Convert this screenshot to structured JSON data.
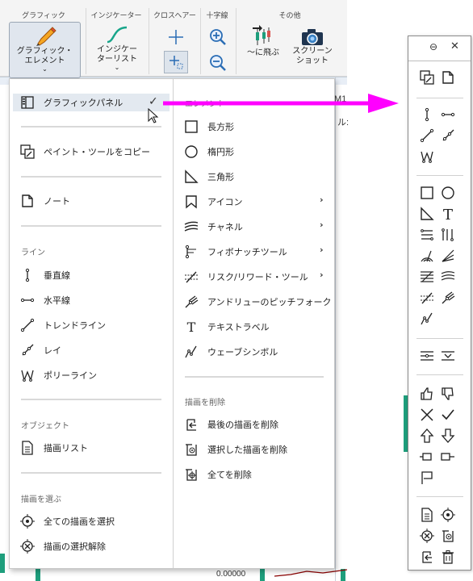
{
  "ribbon": {
    "groups": {
      "graphic": "グラフィック",
      "indicator": "インジケーター",
      "crosshair": "クロスヘアー",
      "cross": "十字線",
      "other": "その他"
    },
    "buttons": {
      "graphic_elements_line1": "グラフィック・",
      "graphic_elements_line2": "エレメント",
      "indicator_list_line1": "インジケー",
      "indicator_list_line2": "ターリスト",
      "goto": "〜に飛ぶ",
      "screenshot_line1": "スクリーン",
      "screenshot_line2": "ショット"
    }
  },
  "chart": {
    "label_m1": "M1",
    "label_partial": "ル:",
    "price_partial": "0.00000"
  },
  "menu": {
    "left": {
      "graphic_panel": "グラフィックパネル",
      "copy_paint_tool": "ペイント・ツールをコピー",
      "note": "ノート",
      "section_line": "ライン",
      "vertical_line": "垂直線",
      "horizontal_line": "水平線",
      "trend_line": "トレンドライン",
      "ray": "レイ",
      "polyline": "ポリーライン",
      "section_object": "オブジェクト",
      "drawing_list": "描画リスト",
      "section_select": "描画を選ぶ",
      "select_all": "全ての描画を選択",
      "deselect": "描画の選択解除"
    },
    "right": {
      "section_element": "エレメント",
      "rectangle": "長方形",
      "ellipse": "楕円形",
      "triangle": "三角形",
      "icon": "アイコン",
      "channel": "チャネル",
      "fibonacci": "フィボナッチツール",
      "risk_reward": "リスク/リワード・ツール",
      "andrews_pitchfork": "アンドリューのピッチフォーク",
      "text_label": "テキストラベル",
      "wave_symbol": "ウェーブシンボル",
      "section_delete": "描画を削除",
      "delete_last": "最後の描画を削除",
      "delete_selected": "選択した描画を削除",
      "delete_all": "全てを削除"
    },
    "checkmark": "✓",
    "submenu_arrow": "›"
  },
  "panel": {
    "minimize_glyph": "⊖",
    "close_glyph": "✕",
    "text_tool_glyph": "T"
  },
  "colors": {
    "arrow": "#ff00ff",
    "green": "#1e9e7c",
    "menu_highlight": "#e3e9f0",
    "accent_blue": "#2a6db5"
  }
}
